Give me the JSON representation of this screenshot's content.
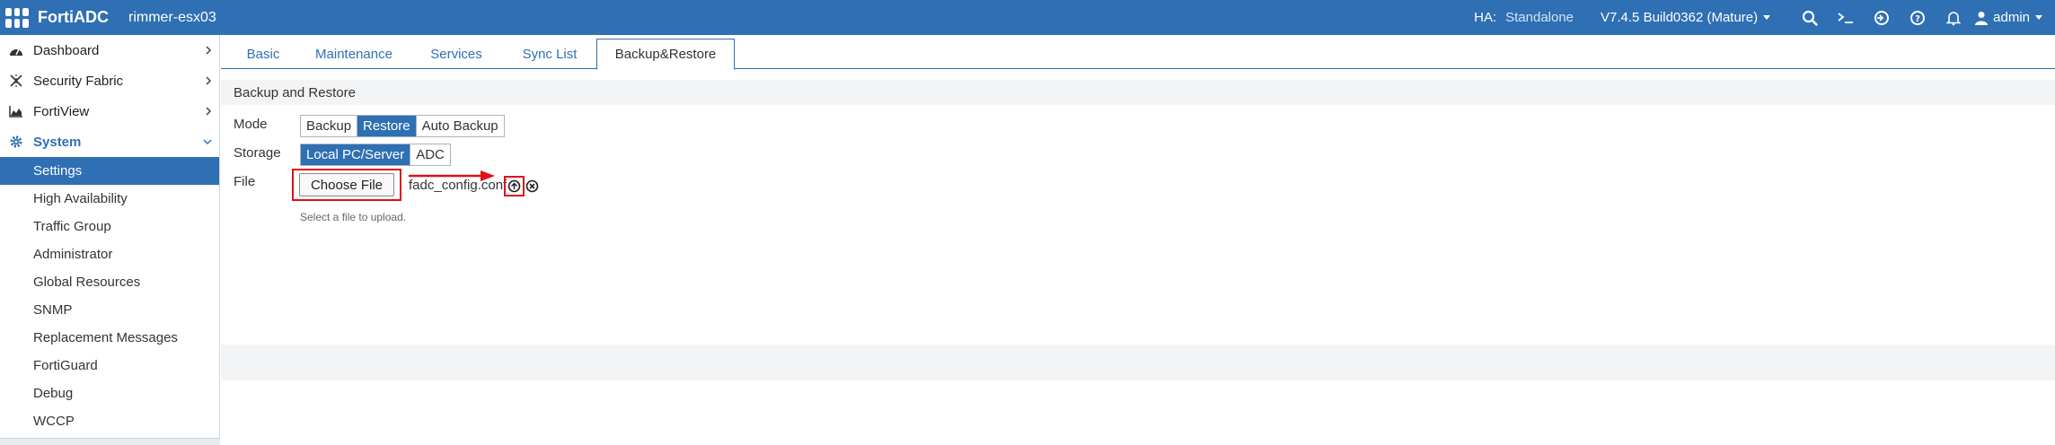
{
  "app": {
    "brand": "FortiADC",
    "host": "rimmer-esx03",
    "accent": "#2f6fb3"
  },
  "topbar": {
    "ha_label": "HA:",
    "ha_value": "Standalone",
    "version": "V7.4.5 Build0362 (Mature)",
    "user": "admin",
    "icons": [
      "search-icon",
      "cli-console-icon",
      "logout-icon",
      "help-icon",
      "bell-icon",
      "user-icon"
    ]
  },
  "sidebar": {
    "items": [
      {
        "label": "Dashboard",
        "icon": "dashboard-icon"
      },
      {
        "label": "Security Fabric",
        "icon": "fabric-icon"
      },
      {
        "label": "FortiView",
        "icon": "chart-icon"
      },
      {
        "label": "System",
        "icon": "gear-icon"
      }
    ],
    "system_children": [
      {
        "label": "Settings",
        "active": true
      },
      {
        "label": "High Availability"
      },
      {
        "label": "Traffic Group"
      },
      {
        "label": "Administrator"
      },
      {
        "label": "Global Resources"
      },
      {
        "label": "SNMP"
      },
      {
        "label": "Replacement Messages"
      },
      {
        "label": "FortiGuard"
      },
      {
        "label": "Debug"
      },
      {
        "label": "WCCP"
      }
    ]
  },
  "tabs": [
    {
      "label": "Basic"
    },
    {
      "label": "Maintenance"
    },
    {
      "label": "Services"
    },
    {
      "label": "Sync List"
    },
    {
      "label": "Backup&Restore",
      "active": true
    }
  ],
  "form": {
    "section_title": "Backup and Restore",
    "mode_label": "Mode",
    "mode_options": [
      "Backup",
      "Restore",
      "Auto Backup"
    ],
    "mode_selected": "Restore",
    "storage_label": "Storage",
    "storage_options": [
      "Local PC/Server",
      "ADC"
    ],
    "storage_selected": "Local PC/Server",
    "file_label": "File",
    "choose_file_label": "Choose File",
    "file_name": "fadc_config.conf",
    "hint": "Select a file to upload."
  },
  "annotation": {
    "color": "#e0101c"
  }
}
